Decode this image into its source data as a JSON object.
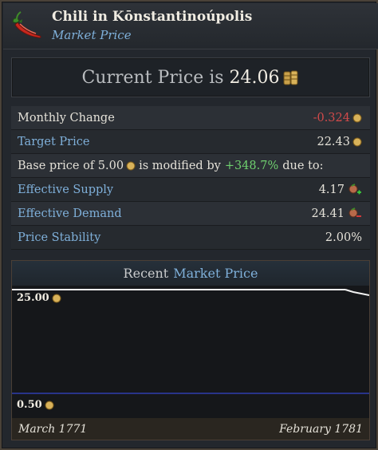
{
  "header": {
    "title": "Chili in Kōnstantinoúpolis",
    "subtitle": "Market Price",
    "icon": "chili-pepper-icon"
  },
  "price": {
    "label": "Current Price is",
    "value": "24.06",
    "icon": "coin-stack-icon"
  },
  "rows": {
    "monthly_change": {
      "label": "Monthly Change",
      "value": "-0.324"
    },
    "target_price": {
      "label": "Target Price",
      "value": "22.43"
    },
    "base_price": {
      "prefix": "Base price of 5.00",
      "middle": "is modified by",
      "percent": "+348.7%",
      "suffix": "due to:"
    },
    "effective_supply": {
      "label": "Effective Supply",
      "value": "4.17",
      "icon": "supply-plus-icon"
    },
    "effective_demand": {
      "label": "Effective Demand",
      "value": "24.41",
      "icon": "demand-minus-icon"
    },
    "price_stability": {
      "label": "Price Stability",
      "value": "2.00%"
    }
  },
  "graph": {
    "title_prefix": "Recent",
    "title_link": "Market Price",
    "y_max_label": "25.00",
    "y_min_label": "0.50",
    "x_start_label": "March 1771",
    "x_end_label": "February 1781"
  },
  "colors": {
    "link": "#7fb0da",
    "negative": "#d24a4a",
    "positive": "#6fd16f",
    "price_line": "#f2f2f2",
    "baseline": "#2f3fb0"
  }
}
